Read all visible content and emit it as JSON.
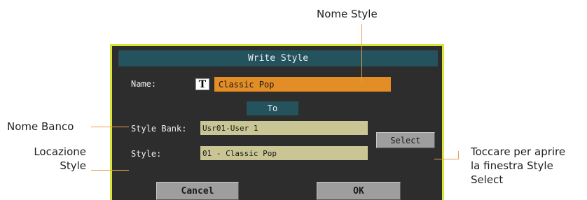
{
  "callouts": {
    "style_name": "Nome Style",
    "bank_name": "Nome Banco",
    "style_location_line1": "Locazione",
    "style_location_line2": "Style",
    "select_hint_line1": "Toccare per aprire",
    "select_hint_line2": "la finestra Style",
    "select_hint_line3": "Select"
  },
  "dialog": {
    "title": "Write Style",
    "name_label": "Name:",
    "text_edit_icon": "T",
    "name_value": "Classic Pop",
    "to_label": "To",
    "bank_label": "Style Bank:",
    "bank_value": "Usr01-User 1",
    "style_label": "Style:",
    "style_value": "01 - Classic Pop",
    "select_button": "Select",
    "cancel_button": "Cancel",
    "ok_button": "OK"
  },
  "colors": {
    "dialog_bg": "#2d2d2d",
    "dialog_border": "#d9e33a",
    "title_bar": "#24535e",
    "name_field": "#e38d26",
    "value_field": "#c9c595",
    "button": "#9e9e9e",
    "leader_line": "#e8a050"
  },
  "icons": {
    "text_edit": "text-edit-icon"
  }
}
